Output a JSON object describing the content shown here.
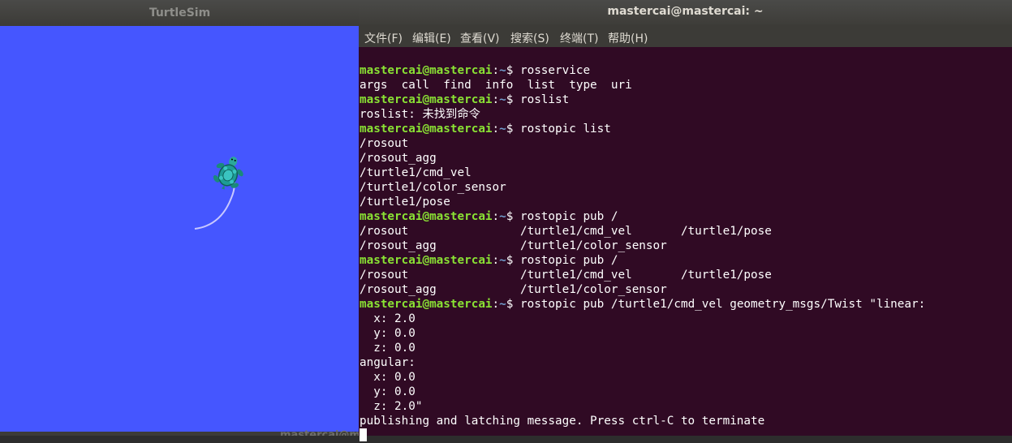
{
  "turtlesim": {
    "title": "TurtleSim",
    "background_color": "#4556ff",
    "trail_color": "#c8c8ff",
    "underlying_text": "mastercai@m"
  },
  "terminal": {
    "title": "mastercai@mastercai: ~",
    "background_color": "#300a24",
    "prompt_user_color": "#8ae234",
    "prompt_path_color": "#729fcf",
    "menu": [
      {
        "label": "文件(F)"
      },
      {
        "label": "编辑(E)"
      },
      {
        "label": "查看(V)"
      },
      {
        "label": "搜索(S)"
      },
      {
        "label": "终端(T)"
      },
      {
        "label": "帮助(H)"
      }
    ],
    "prompt": {
      "user_host": "mastercai@mastercai",
      "colon": ":",
      "path": "~",
      "symbol": "$ "
    },
    "lines": [
      {
        "type": "prompt",
        "cmd": "rosservice"
      },
      {
        "type": "output",
        "text": "args  call  find  info  list  type  uri"
      },
      {
        "type": "prompt",
        "cmd": "roslist"
      },
      {
        "type": "output",
        "text": "roslist: 未找到命令"
      },
      {
        "type": "prompt",
        "cmd": "rostopic list"
      },
      {
        "type": "output",
        "text": "/rosout"
      },
      {
        "type": "output",
        "text": "/rosout_agg"
      },
      {
        "type": "output",
        "text": "/turtle1/cmd_vel"
      },
      {
        "type": "output",
        "text": "/turtle1/color_sensor"
      },
      {
        "type": "output",
        "text": "/turtle1/pose"
      },
      {
        "type": "prompt",
        "cmd": "rostopic pub /"
      },
      {
        "type": "output",
        "text": "/rosout                /turtle1/cmd_vel       /turtle1/pose"
      },
      {
        "type": "output",
        "text": "/rosout_agg            /turtle1/color_sensor"
      },
      {
        "type": "prompt",
        "cmd": "rostopic pub /"
      },
      {
        "type": "output",
        "text": "/rosout                /turtle1/cmd_vel       /turtle1/pose"
      },
      {
        "type": "output",
        "text": "/rosout_agg            /turtle1/color_sensor"
      },
      {
        "type": "prompt",
        "cmd": "rostopic pub /turtle1/cmd_vel geometry_msgs/Twist \"linear:"
      },
      {
        "type": "output",
        "text": "  x: 2.0"
      },
      {
        "type": "output",
        "text": "  y: 0.0"
      },
      {
        "type": "output",
        "text": "  z: 0.0"
      },
      {
        "type": "output",
        "text": "angular:"
      },
      {
        "type": "output",
        "text": "  x: 0.0"
      },
      {
        "type": "output",
        "text": "  y: 0.0"
      },
      {
        "type": "output",
        "text": "  z: 2.0\""
      },
      {
        "type": "output",
        "text": "publishing and latching message. Press ctrl-C to terminate"
      },
      {
        "type": "cursor"
      }
    ]
  }
}
